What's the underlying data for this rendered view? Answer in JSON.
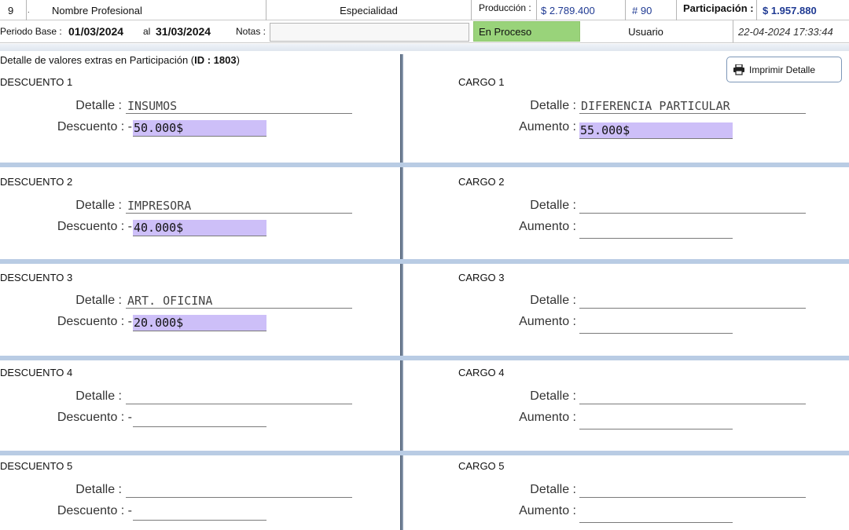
{
  "header": {
    "row_number": "9",
    "dot": ".",
    "professional_name": "Nombre Profesional",
    "specialty": "Especialidad",
    "production_label": "Producción :",
    "production_value": "$ 2.789.400",
    "count_value": "# 90",
    "participation_label": "Participación :",
    "participation_value": "$ 1.957.880"
  },
  "period": {
    "label": "Periodo Base :",
    "from": "01/03/2024",
    "to_label": "al",
    "to": "31/03/2024",
    "notes_label": "Notas :",
    "notes_value": "",
    "status": "En Proceso",
    "user_label": "Usuario",
    "timestamp": "22-04-2024 17:33:44"
  },
  "detail": {
    "title_prefix": "Detalle de valores extras en Participación (",
    "id_label": "ID : 1803",
    "title_suffix": ")",
    "print_button": "Imprimir Detalle"
  },
  "labels": {
    "detalle": "Detalle :",
    "descuento": "Descuento : -",
    "aumento": "Aumento :"
  },
  "discounts": [
    {
      "title": "DESCUENTO 1",
      "detail": "INSUMOS",
      "amount": "50.000$"
    },
    {
      "title": "DESCUENTO 2",
      "detail": "IMPRESORA",
      "amount": "40.000$"
    },
    {
      "title": "DESCUENTO 3",
      "detail": "ART. OFICINA",
      "amount": "20.000$"
    },
    {
      "title": "DESCUENTO 4",
      "detail": "",
      "amount": ""
    },
    {
      "title": "DESCUENTO 5",
      "detail": "",
      "amount": ""
    }
  ],
  "charges": [
    {
      "title": "CARGO 1",
      "detail": "DIFERENCIA PARTICULAR",
      "amount": "55.000$"
    },
    {
      "title": "CARGO 2",
      "detail": "",
      "amount": ""
    },
    {
      "title": "CARGO 3",
      "detail": "",
      "amount": ""
    },
    {
      "title": "CARGO 4",
      "detail": "",
      "amount": ""
    },
    {
      "title": "CARGO 5",
      "detail": "",
      "amount": ""
    }
  ],
  "colors": {
    "status_green": "#99d37a",
    "value_highlight": "#cdbff8",
    "band_blue": "#b9cce4"
  },
  "icons": {
    "print": "printer-icon"
  }
}
